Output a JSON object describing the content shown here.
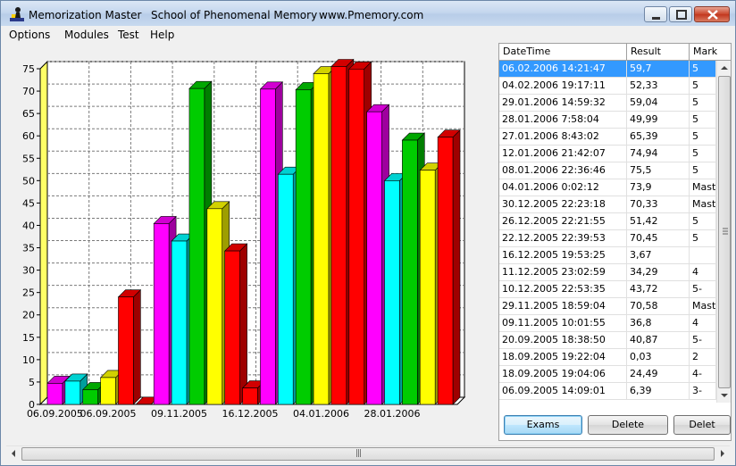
{
  "window": {
    "app_name": "Memorization Master",
    "subtitle": "School of Phenomenal Memory",
    "website": "www.Pmemory.com"
  },
  "menu": [
    "Options",
    "Modules",
    "Test",
    "Help"
  ],
  "chart_data": {
    "type": "bar",
    "title": "",
    "xlabel": "",
    "ylabel": "",
    "ylim": [
      0,
      75
    ],
    "yticks": [
      0,
      5,
      10,
      15,
      20,
      25,
      30,
      35,
      40,
      45,
      50,
      55,
      60,
      65,
      70,
      75
    ],
    "x_tick_labels": [
      "06.09.2005",
      "06.09.2005",
      "09.11.2005",
      "16.12.2005",
      "04.01.2006",
      "28.01.2006"
    ],
    "grid": true,
    "bars": [
      {
        "date": "06.09.2005 14:09:01",
        "value": 4.7,
        "color": "#ff00ff"
      },
      {
        "date": "06.09.2005",
        "value": 5.2,
        "color": "#00ffff"
      },
      {
        "date": "06.09.2005",
        "value": 3.3,
        "color": "#00cc00"
      },
      {
        "date": "06.09.2005",
        "value": 6.0,
        "color": "#ffff00"
      },
      {
        "date": "18.09.2005 19:04:06",
        "value": 24.0,
        "color": "#ff0000"
      },
      {
        "date": "18.09.2005 19:22:04",
        "value": 0.03,
        "color": "#ff0000"
      },
      {
        "date": "20.09.2005 18:38:50",
        "value": 40.4,
        "color": "#ff00ff"
      },
      {
        "date": "09.11.2005 10:01:55",
        "value": 36.5,
        "color": "#00ffff"
      },
      {
        "date": "29.11.2005 18:59:04",
        "value": 70.58,
        "color": "#00cc00"
      },
      {
        "date": "10.12.2005 22:53:35",
        "value": 43.72,
        "color": "#ffff00"
      },
      {
        "date": "11.12.2005 23:02:59",
        "value": 34.29,
        "color": "#ff0000"
      },
      {
        "date": "16.12.2005 19:53:25",
        "value": 3.67,
        "color": "#ff0000"
      },
      {
        "date": "22.12.2005 22:39:53",
        "value": 70.45,
        "color": "#ff00ff"
      },
      {
        "date": "26.12.2005 22:21:55",
        "value": 51.42,
        "color": "#00ffff"
      },
      {
        "date": "30.12.2005 22:23:18",
        "value": 70.33,
        "color": "#00cc00"
      },
      {
        "date": "04.01.2006 0:02:12",
        "value": 73.9,
        "color": "#ffff00"
      },
      {
        "date": "08.01.2006 22:36:46",
        "value": 75.5,
        "color": "#ff0000"
      },
      {
        "date": "12.01.2006 21:42:07",
        "value": 74.94,
        "color": "#ff0000"
      },
      {
        "date": "27.01.2006 8:43:02",
        "value": 65.39,
        "color": "#ff00ff"
      },
      {
        "date": "28.01.2006 7:58:04",
        "value": 49.99,
        "color": "#00ffff"
      },
      {
        "date": "29.01.2006 14:59:32",
        "value": 59.04,
        "color": "#00cc00"
      },
      {
        "date": "04.02.2006 19:17:11",
        "value": 52.33,
        "color": "#ffff00"
      },
      {
        "date": "06.02.2006 14:21:47",
        "value": 59.7,
        "color": "#ff0000"
      }
    ]
  },
  "results_table": {
    "columns": [
      "DateTime",
      "Result",
      "Mark"
    ],
    "rows": [
      {
        "datetime": "06.02.2006 14:21:47",
        "result": "59,7",
        "mark": "5",
        "selected": true
      },
      {
        "datetime": "04.02.2006 19:17:11",
        "result": "52,33",
        "mark": "5"
      },
      {
        "datetime": "29.01.2006 14:59:32",
        "result": "59,04",
        "mark": "5"
      },
      {
        "datetime": "28.01.2006 7:58:04",
        "result": "49,99",
        "mark": "5"
      },
      {
        "datetime": "27.01.2006 8:43:02",
        "result": "65,39",
        "mark": "5"
      },
      {
        "datetime": "12.01.2006 21:42:07",
        "result": "74,94",
        "mark": "5"
      },
      {
        "datetime": "08.01.2006 22:36:46",
        "result": "75,5",
        "mark": "5"
      },
      {
        "datetime": "04.01.2006 0:02:12",
        "result": "73,9",
        "mark": "Maste"
      },
      {
        "datetime": "30.12.2005 22:23:18",
        "result": "70,33",
        "mark": "Maste"
      },
      {
        "datetime": "26.12.2005 22:21:55",
        "result": "51,42",
        "mark": "5"
      },
      {
        "datetime": "22.12.2005 22:39:53",
        "result": "70,45",
        "mark": "5"
      },
      {
        "datetime": "16.12.2005 19:53:25",
        "result": "3,67",
        "mark": ""
      },
      {
        "datetime": "11.12.2005 23:02:59",
        "result": "34,29",
        "mark": "4"
      },
      {
        "datetime": "10.12.2005 22:53:35",
        "result": "43,72",
        "mark": "5-"
      },
      {
        "datetime": "29.11.2005 18:59:04",
        "result": "70,58",
        "mark": "Maste"
      },
      {
        "datetime": "09.11.2005 10:01:55",
        "result": "36,8",
        "mark": "4"
      },
      {
        "datetime": "20.09.2005 18:38:50",
        "result": "40,87",
        "mark": "5-"
      },
      {
        "datetime": "18.09.2005 19:22:04",
        "result": "0,03",
        "mark": "2"
      },
      {
        "datetime": "18.09.2005 19:04:06",
        "result": "24,49",
        "mark": "4-"
      },
      {
        "datetime": "06.09.2005 14:09:01",
        "result": "6,39",
        "mark": "3-"
      }
    ]
  },
  "buttons": {
    "exams": "Exams",
    "delete": "Delete",
    "delete2": "Delet"
  },
  "colors": {
    "selection": "#3399ff",
    "chart_yellow_wall": "#ffff66"
  }
}
